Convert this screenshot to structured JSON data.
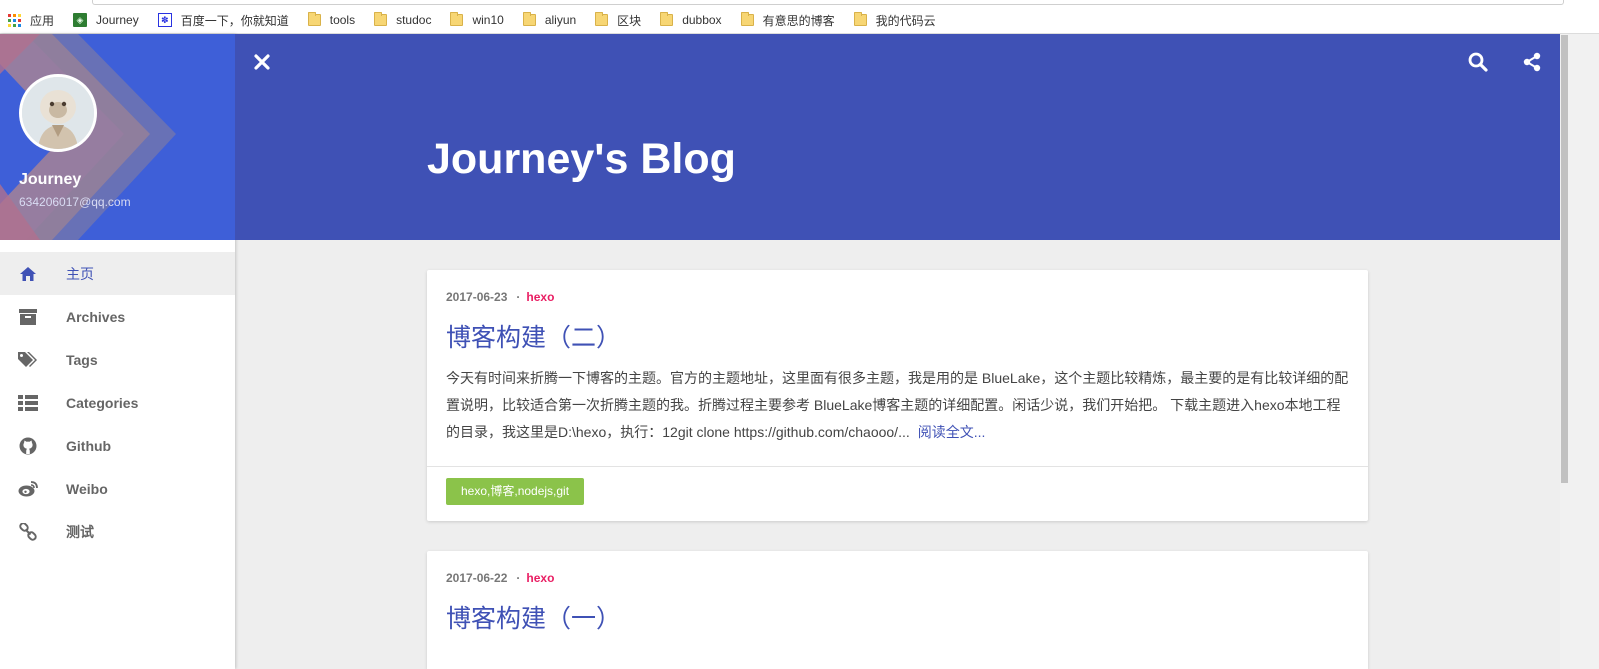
{
  "bookmarks": [
    {
      "label": "应用",
      "icon": "apps-grid-icon"
    },
    {
      "label": "Journey",
      "icon": "green-site-icon"
    },
    {
      "label": "百度一下，你就知道",
      "icon": "baidu-paw-icon"
    },
    {
      "label": "tools",
      "icon": "folder-icon"
    },
    {
      "label": "studoc",
      "icon": "folder-icon"
    },
    {
      "label": "win10",
      "icon": "folder-icon"
    },
    {
      "label": "aliyun",
      "icon": "folder-icon"
    },
    {
      "label": "区块",
      "icon": "folder-icon"
    },
    {
      "label": "dubbox",
      "icon": "folder-icon"
    },
    {
      "label": "有意思的博客",
      "icon": "folder-icon"
    },
    {
      "label": "我的代码云",
      "icon": "folder-icon"
    }
  ],
  "profile": {
    "name": "Journey",
    "email": "634206017@qq.com"
  },
  "nav": [
    {
      "label": "主页",
      "icon": "home-icon",
      "active": true
    },
    {
      "label": "Archives",
      "icon": "archive-box-icon"
    },
    {
      "label": "Tags",
      "icon": "tags-icon"
    },
    {
      "label": "Categories",
      "icon": "list-icon"
    },
    {
      "label": "Github",
      "icon": "github-icon"
    },
    {
      "label": "Weibo",
      "icon": "weibo-icon"
    },
    {
      "label": "测试",
      "icon": "link-icon"
    }
  ],
  "header": {
    "title": "Journey's Blog"
  },
  "posts": [
    {
      "date": "2017-06-23",
      "separator": "·",
      "category": "hexo",
      "title": "博客构建（二）",
      "excerpt": "今天有时间来折腾一下博客的主题。官方的主题地址，这里面有很多主题，我是用的是 BlueLake，这个主题比较精炼，最主要的是有比较详细的配置说明，比较适合第一次折腾主题的我。折腾过程主要参考 BlueLake博客主题的详细配置。闲话少说，我们开始把。 下载主题进入hexo本地工程的目录，我这里是D:\\hexo，执行：12git clone https://github.com/chaooo/...",
      "read_more": "阅读全文...",
      "tags": "hexo,博客,nodejs,git"
    },
    {
      "date": "2017-06-22",
      "separator": "·",
      "category": "hexo",
      "title": "博客构建（一）"
    }
  ],
  "colors": {
    "primary": "#3f51b5",
    "accent": "#e91e63",
    "tag": "#8bc34a"
  }
}
